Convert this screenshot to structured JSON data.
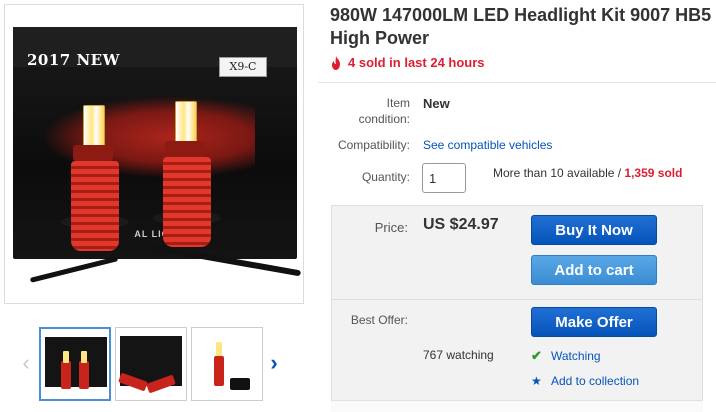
{
  "product": {
    "title_line1": "980W 147000LM LED Headlight Kit 9007 HB5",
    "title_line2": "High Power",
    "sold_recent": "4 sold in last 24 hours"
  },
  "image": {
    "box_year_text": "2017 NEW",
    "box_model_text": "X9-C",
    "box_band_text": "AL  LIGHT  M"
  },
  "details": {
    "condition_label": "Item condition:",
    "condition_value": "New",
    "compat_label": "Compatibility:",
    "compat_link": "See compatible vehicles",
    "quantity_label": "Quantity:",
    "quantity_value": "1",
    "available_text": "More than 10 available / ",
    "sold_count": "1,359 sold"
  },
  "purchase": {
    "price_label": "Price:",
    "price_value": "US $24.97",
    "buy_now": "Buy It Now",
    "add_to_cart": "Add to cart",
    "best_offer_label": "Best Offer:",
    "make_offer": "Make Offer",
    "watching_count": "767 watching",
    "watching_link": "Watching",
    "collection_link": "Add to collection"
  },
  "icons": {
    "fire": "fire-icon",
    "check": "check-icon",
    "star": "star-icon",
    "prev": "chevron-left-icon",
    "next": "chevron-right-icon"
  },
  "colors": {
    "brand_blue": "#0654ba",
    "cart_blue": "#3a8dd4",
    "alert_red": "#dd1e31",
    "check_green": "#2c9a2c"
  }
}
